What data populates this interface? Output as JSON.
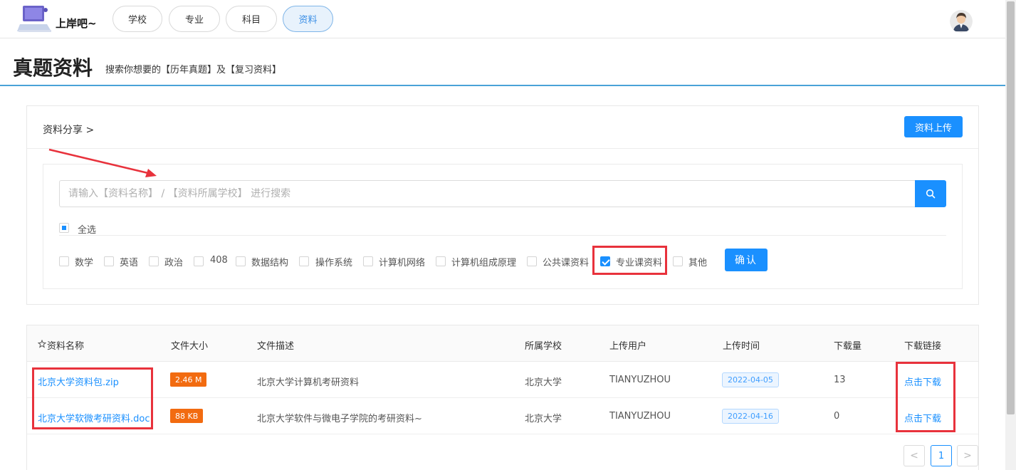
{
  "header": {
    "logo_text": "上岸吧~",
    "nav": [
      "学校",
      "专业",
      "科目",
      "资料"
    ],
    "active_nav": "资料"
  },
  "page": {
    "title": "真题资料",
    "subtitle": "搜索你想要的【历年真题】及【复习资料】"
  },
  "card": {
    "title": "资料分享 >",
    "upload_button": "资料上传",
    "search_placeholder": "请输入【资料名称】 / 【资料所属学校】 进行搜索",
    "select_all": "全选",
    "categories": [
      {
        "label": "数学",
        "checked": false
      },
      {
        "label": "英语",
        "checked": false
      },
      {
        "label": "政治",
        "checked": false
      },
      {
        "label": "408",
        "checked": false
      },
      {
        "label": "数据结构",
        "checked": false
      },
      {
        "label": "操作系统",
        "checked": false
      },
      {
        "label": "计算机网络",
        "checked": false
      },
      {
        "label": "计算机组成原理",
        "checked": false
      },
      {
        "label": "公共课资料",
        "checked": false
      },
      {
        "label": "专业课资料",
        "checked": true
      },
      {
        "label": "其他",
        "checked": false
      }
    ],
    "confirm_button": "确认"
  },
  "table": {
    "columns": [
      "资料名称",
      "文件大小",
      "文件描述",
      "所属学校",
      "上传用户",
      "上传时间",
      "下载量",
      "下载链接"
    ],
    "rows": [
      {
        "name": "北京大学资料包.zip",
        "size": "2.46 M",
        "desc": "北京大学计算机考研资料",
        "school": "北京大学",
        "user": "TIANYUZHOU",
        "date": "2022-04-05",
        "downloads": "13",
        "link": "点击下载"
      },
      {
        "name": "北京大学软微考研资料.doc",
        "size": "88 KB",
        "desc": "北京大学软件与微电子学院的考研资料~",
        "school": "北京大学",
        "user": "TIANYUZHOU",
        "date": "2022-04-16",
        "downloads": "0",
        "link": "点击下载"
      }
    ]
  },
  "pagination": {
    "prev": "<",
    "current": "1",
    "next": ">"
  },
  "colors": {
    "primary": "#1a90ff",
    "highlight": "#e8323c",
    "size_tag": "#f26b10",
    "title_line": "#4aa2d8"
  },
  "icons": [
    "laptop-logo-icon",
    "avatar-icon",
    "search-icon",
    "star-icon"
  ]
}
